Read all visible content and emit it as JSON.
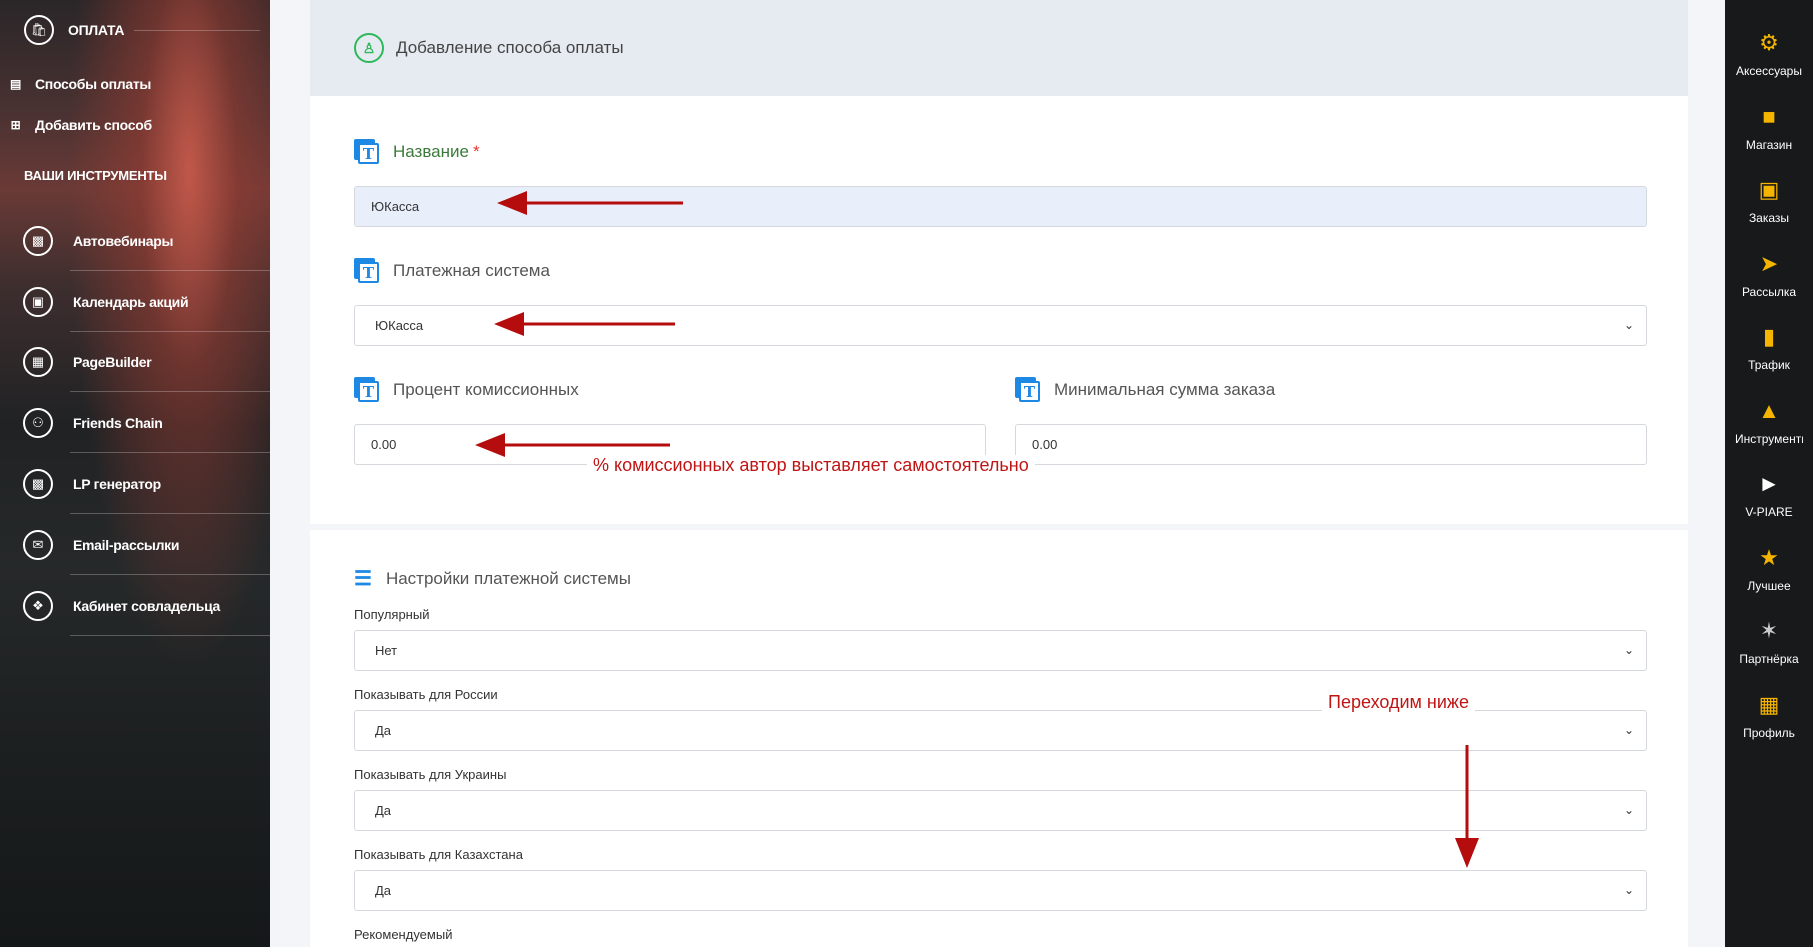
{
  "sidebar": {
    "header": "ОПЛАТА",
    "sub_items": [
      {
        "label": "Способы оплаты",
        "icon": "list-icon"
      },
      {
        "label": "Добавить способ",
        "icon": "plus-icon"
      }
    ],
    "section_title": "ВАШИ ИНСТРУМЕНТЫ",
    "tools": [
      {
        "label": "Автовебинары",
        "icon": "webinar-icon"
      },
      {
        "label": "Календарь акций",
        "icon": "calendar-icon"
      },
      {
        "label": "PageBuilder",
        "icon": "pagebuilder-icon"
      },
      {
        "label": "Friends Chain",
        "icon": "friends-icon"
      },
      {
        "label": "LP генератор",
        "icon": "lp-icon"
      },
      {
        "label": "Email-рассылки",
        "icon": "email-icon"
      },
      {
        "label": "Кабинет совладельца",
        "icon": "handshake-icon"
      }
    ]
  },
  "form": {
    "header_title": "Добавление способа оплаты",
    "name_label": "Название",
    "name_required": "*",
    "name_value": "ЮКасса",
    "system_label": "Платежная система",
    "system_value": "ЮКасса",
    "commission_label": "Процент комиссионных",
    "commission_value": "0.00",
    "min_sum_label": "Минимальная сумма заказа",
    "min_sum_value": "0.00",
    "settings_title": "Настройки платежной системы",
    "settings": [
      {
        "label": "Популярный",
        "value": "Нет"
      },
      {
        "label": "Показывать для России",
        "value": "Да"
      },
      {
        "label": "Показывать для Украины",
        "value": "Да"
      },
      {
        "label": "Показывать для Казахстана",
        "value": "Да"
      }
    ],
    "recommended_label": "Рекомендуемый"
  },
  "annotations": {
    "commission_note": "% комиссионных автор выставляет самостоятельно",
    "scroll_note": "Переходим ниже",
    "color": "#c01515"
  },
  "rightbar": {
    "items": [
      {
        "label": "Аксессуары",
        "icon": "accessories-icon"
      },
      {
        "label": "Магазин",
        "icon": "shop-icon"
      },
      {
        "label": "Заказы",
        "icon": "orders-icon"
      },
      {
        "label": "Рассылка",
        "icon": "mailing-icon"
      },
      {
        "label": "Трафик",
        "icon": "traffic-icon"
      },
      {
        "label": "Инструменты",
        "icon": "tools-icon"
      },
      {
        "label": "V-PIARE",
        "icon": "megaphone-icon"
      },
      {
        "label": "Лучшее",
        "icon": "best-icon"
      },
      {
        "label": "Партнёрка",
        "icon": "partner-icon"
      },
      {
        "label": "Профиль",
        "icon": "profile-icon"
      }
    ]
  }
}
